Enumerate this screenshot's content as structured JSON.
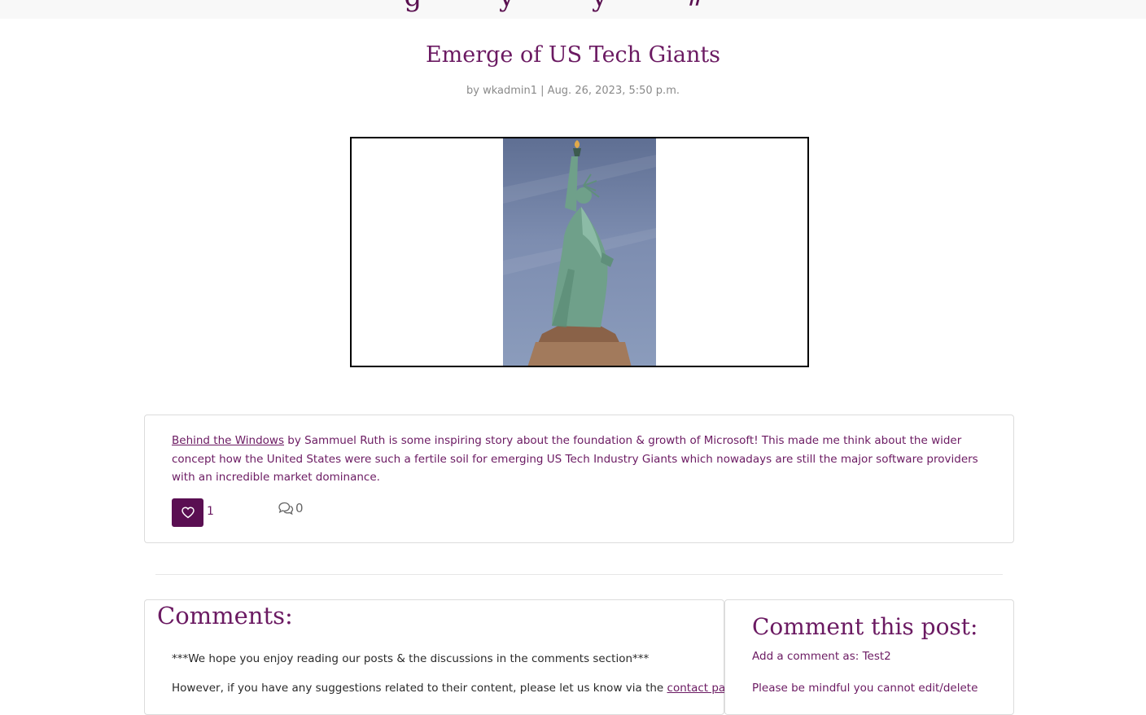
{
  "header": {
    "cut_text": "g y y #"
  },
  "post": {
    "title": "Emerge of US Tech Giants",
    "byline": "by wkadmin1 | Aug. 26, 2023, 5:50 p.m."
  },
  "excerpt": {
    "link_text": "Behind the Windows",
    "text": " by Sammuel Ruth is some inspiring story about the foundation & growth of Microsoft! This made me think about the wider concept how the United States were such a fertile soil for emerging US Tech Industry Giants which nowadays are still the major software providers with an incredible market dominance.",
    "like_count": "1",
    "comment_count": "0",
    "icons": {
      "like": "heart-icon",
      "comments": "speech-bubbles-icon"
    },
    "colors": {
      "accent": "#5a0f52"
    }
  },
  "comments": {
    "heading": "Comments:",
    "note": "***We hope you enjoy reading our posts & the discussions in the comments section***",
    "sub_text": "However, if you have any suggestions related to their content, please let us know via the ",
    "sub_link": "contact page"
  },
  "comment_form": {
    "heading": "Comment this post:",
    "add_as": "Add a comment as: Test2",
    "mindful": "Please be mindful you cannot edit/delete"
  }
}
